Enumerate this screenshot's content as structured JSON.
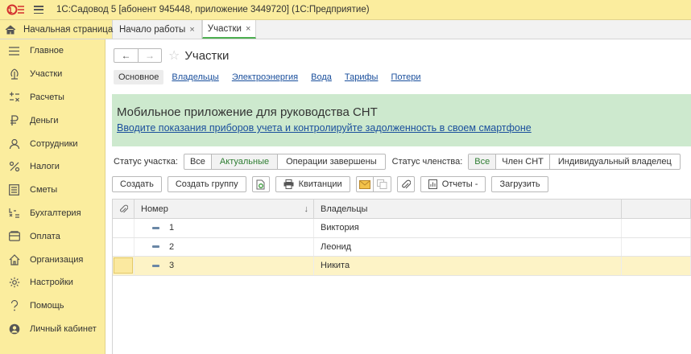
{
  "window": {
    "title": "1С:Садовод 5 [абонент 945448, приложение 3449720]  (1С:Предприятие)",
    "logo_text": "1С"
  },
  "tabs": {
    "home_label": "Начальная страница",
    "items": [
      {
        "label": "Начало работы",
        "close": "×"
      },
      {
        "label": "Участки",
        "close": "×"
      }
    ]
  },
  "sidebar": {
    "items": [
      {
        "label": "Главное",
        "icon": "menu-icon"
      },
      {
        "label": "Участки",
        "icon": "plots-icon"
      },
      {
        "label": "Расчеты",
        "icon": "calc-icon"
      },
      {
        "label": "Деньги",
        "icon": "ruble-icon"
      },
      {
        "label": "Сотрудники",
        "icon": "person-icon"
      },
      {
        "label": "Налоги",
        "icon": "percent-icon"
      },
      {
        "label": "Сметы",
        "icon": "estimate-icon"
      },
      {
        "label": "Бухгалтерия",
        "icon": "accounting-icon"
      },
      {
        "label": "Оплата",
        "icon": "payment-icon"
      },
      {
        "label": "Организация",
        "icon": "organization-icon"
      },
      {
        "label": "Настройки",
        "icon": "settings-icon"
      },
      {
        "label": "Помощь",
        "icon": "help-icon"
      },
      {
        "label": "Личный кабинет",
        "icon": "account-icon"
      }
    ]
  },
  "page": {
    "title": "Участки",
    "links": [
      "Основное",
      "Владельцы",
      "Электроэнергия",
      "Вода",
      "Тарифы",
      "Потери"
    ]
  },
  "banner": {
    "title": "Мобильное приложение для руководства СНТ",
    "link": "Вводите показания приборов учета и контролируйте задолженность в своем смартфоне"
  },
  "filters": {
    "status_label": "Статус участка:",
    "status_options": [
      "Все",
      "Актуальные",
      "Операции завершены"
    ],
    "status_selected": "Актуальные",
    "membership_label": "Статус членства:",
    "membership_options": [
      "Все",
      "Член СНТ",
      "Индивидуальный владелец"
    ],
    "membership_selected": "Все"
  },
  "commands": {
    "create": "Создать",
    "create_group": "Создать группу",
    "receipts": "Квитанции",
    "reports": "Отчеты -",
    "load": "Загрузить"
  },
  "table": {
    "columns": [
      "Номер",
      "Владельцы"
    ],
    "sort_indicator": "↓",
    "rows": [
      {
        "number": "1",
        "owner": "Виктория"
      },
      {
        "number": "2",
        "owner": "Леонид"
      },
      {
        "number": "3",
        "owner": "Никита"
      }
    ],
    "selected_row": 2
  },
  "colors": {
    "accent_yellow": "#fbed9e",
    "banner_green": "#cde9ce",
    "link_blue": "#1a4f9c",
    "selected_green": "#2e7d32"
  }
}
